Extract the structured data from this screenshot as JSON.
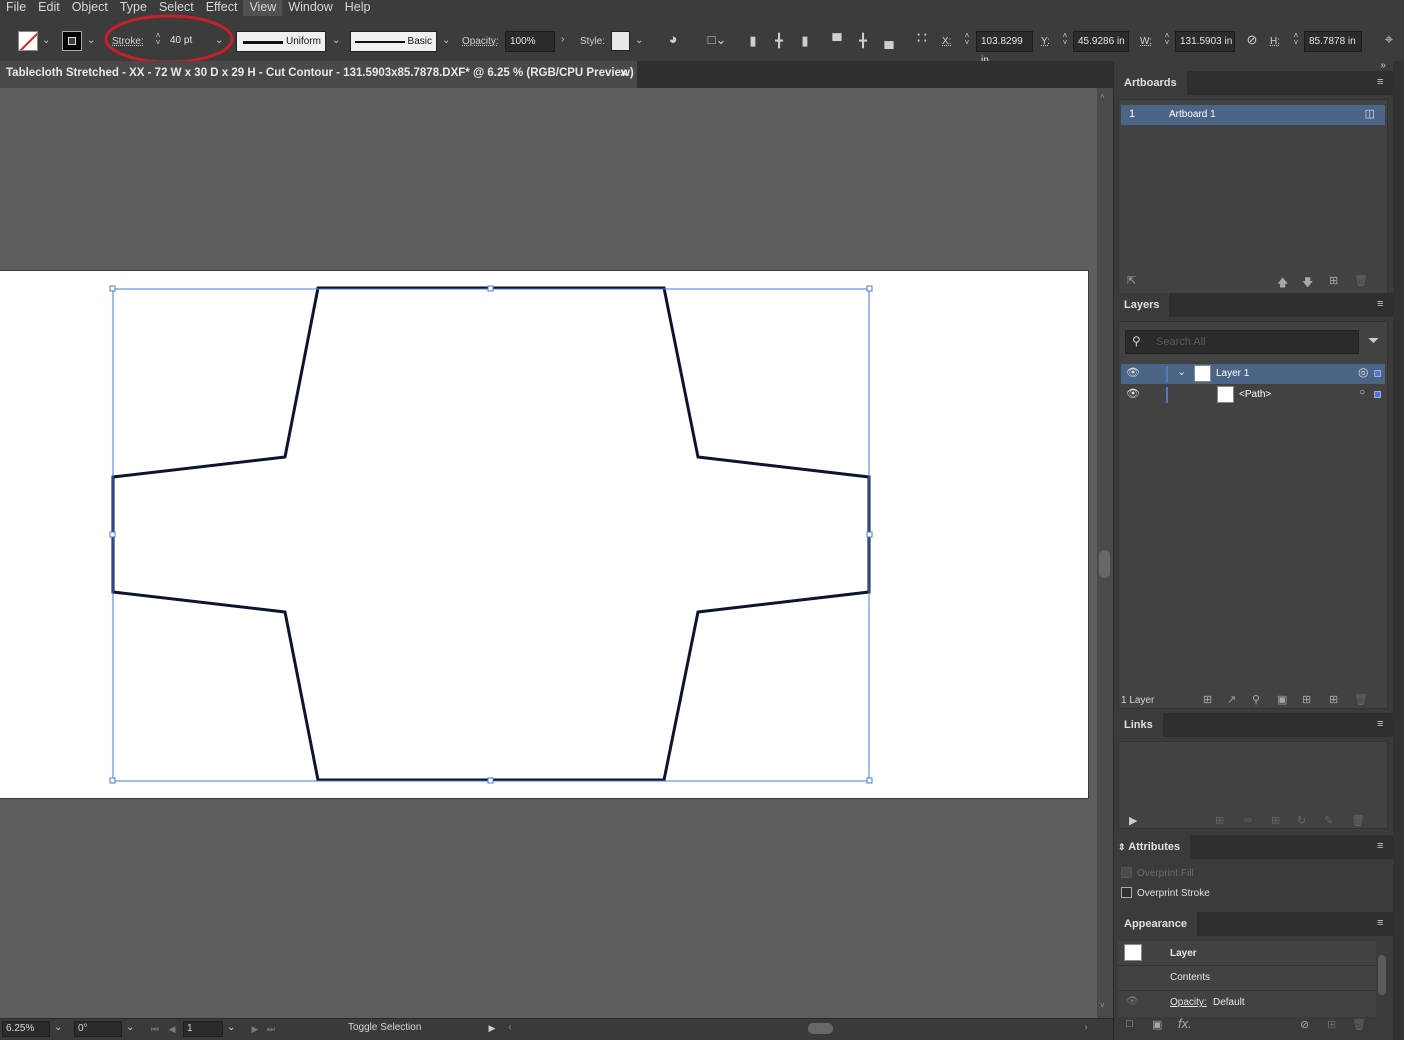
{
  "menu": [
    "File",
    "Edit",
    "Object",
    "Type",
    "Select",
    "Effect",
    "View",
    "Window",
    "Help"
  ],
  "menu_active": "View",
  "control": {
    "stroke_label": "Stroke:",
    "stroke_value": "40 pt",
    "profile_label": "Uniform",
    "brush_label": "Basic",
    "opacity_label": "Opacity:",
    "opacity_value": "100%",
    "style_label": "Style:",
    "x_label": "X:",
    "x_value": "103.8299 in",
    "y_label": "Y:",
    "y_value": "45.9286 in",
    "w_label": "W:",
    "w_value": "131.5903 in",
    "h_label": "H:",
    "h_value": "85.7878 in",
    "highlight_color": "#c8202a"
  },
  "document": {
    "tab_title": "Tablecloth Stretched - XX - 72 W x 30 D x 29 H - Cut Contour - 131.5903x85.7878.DXF* @ 6.25 % (RGB/CPU Preview)",
    "close_glyph": "×"
  },
  "status": {
    "zoom": "6.25%",
    "rotation": "0°",
    "artboard_num": "1",
    "tool_status": "Toggle Selection"
  },
  "artboards_panel": {
    "title": "Artboards",
    "items": [
      {
        "num": "1",
        "name": "Artboard 1"
      }
    ]
  },
  "layers_panel": {
    "title": "Layers",
    "search_placeholder": "Search All",
    "items": [
      {
        "name": "Layer 1"
      },
      {
        "name": "<Path>"
      }
    ],
    "count": "1 Layer"
  },
  "links_panel": {
    "title": "Links"
  },
  "attributes_panel": {
    "title": "Attributes",
    "overprint_fill": "Overprint Fill",
    "overprint_stroke": "Overprint Stroke"
  },
  "appearance_panel": {
    "title": "Appearance",
    "layer_label": "Layer",
    "contents_label": "Contents",
    "opacity_label": "Opacity:",
    "opacity_value": "Default"
  },
  "colors": {
    "selection": "#4a7bd0",
    "panel_selected": "#4b6587",
    "path_stroke": "#0d1430"
  }
}
